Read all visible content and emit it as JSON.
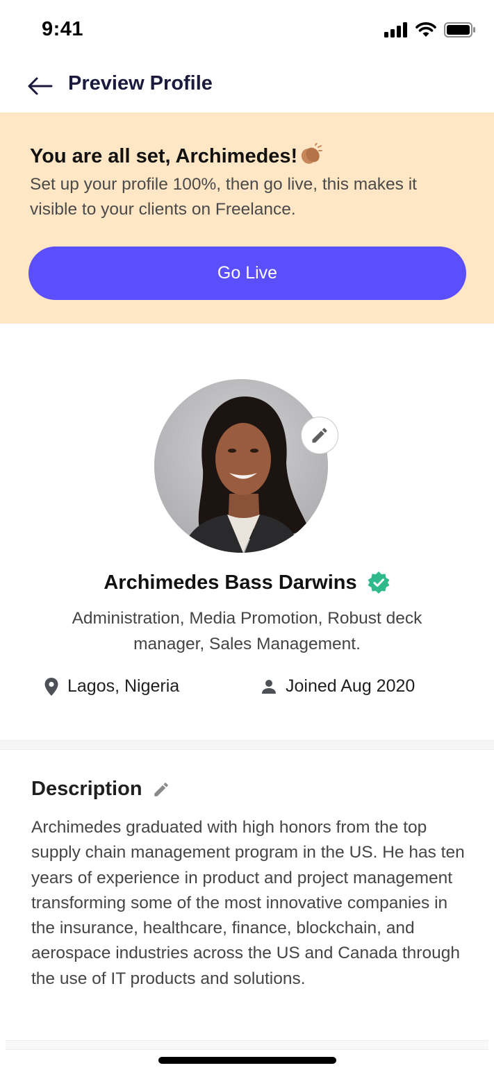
{
  "status_bar": {
    "time": "9:41",
    "icons": [
      "signal-icon",
      "wifi-icon",
      "battery-icon"
    ]
  },
  "header": {
    "back_icon": "arrow-left-icon",
    "title": "Preview Profile"
  },
  "banner": {
    "title": "You are all set, Archimedes!",
    "title_emoji": "clapping-hands-icon",
    "text": "Set up your profile 100%, then go live, this makes it visible to your clients on Freelance.",
    "button_label": "Go Live",
    "background": "#ffe6c4",
    "button_color": "#5a4ffa"
  },
  "profile": {
    "avatar": "profile-photo",
    "edit_icon": "pencil-icon",
    "name": "Archimedes Bass Darwins",
    "verified_icon": "verified-badge-icon",
    "verified_color": "#2fb98c",
    "skills": "Administration, Media Promotion, Robust deck manager, Sales Management.",
    "location": "Lagos, Nigeria",
    "location_icon": "map-pin-icon",
    "joined": "Joined Aug 2020",
    "joined_icon": "user-icon"
  },
  "description": {
    "title": "Description",
    "edit_icon": "pencil-icon",
    "body": "Archimedes graduated with high honors from the top supply chain management program in the US. He has ten years of experience in product and project management transforming some of the most innovative companies in the insurance, healthcare, finance, blockchain, and aerospace industries across the US and Canada through the use of IT products and solutions."
  }
}
